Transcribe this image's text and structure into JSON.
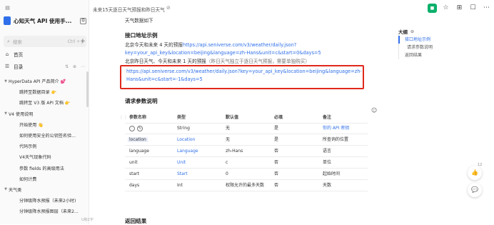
{
  "app": {
    "title": "心知天气 API 使用手...",
    "titlebar_icon": "tiny-window-icon"
  },
  "breadcrumb": {
    "text": "未来15天逐日天气预报和昨日天气"
  },
  "sidebar": {
    "search_placeholder": "搜索",
    "search_shortcut": "Ctrl + J",
    "nav": [
      {
        "label": "首页",
        "icon": "home-icon"
      },
      {
        "label": "目录",
        "icon": "list-icon",
        "tools": "⇅ ⊕ ⋯"
      }
    ],
    "tree": [
      {
        "label": "HyperData API 产品简介 💕",
        "indent": 1,
        "caret": true
      },
      {
        "label": "跳转至数据目录 👉",
        "indent": 2
      },
      {
        "label": "跳转至 V3 版 API 文档 👉",
        "indent": 2
      },
      {
        "label": "V4 使用说明",
        "indent": 1,
        "caret": true
      },
      {
        "label": "开始使用 👋",
        "indent": 2
      },
      {
        "label": "如何使用安全的公钥签名验...",
        "indent": 2
      },
      {
        "label": "代码示例",
        "indent": 2
      },
      {
        "label": "V4天气现象代码",
        "indent": 2
      },
      {
        "label": "参数 fields 的高级用法",
        "indent": 2
      },
      {
        "label": "如何计费",
        "indent": 2
      },
      {
        "label": "天气类",
        "indent": 1,
        "caret": true
      },
      {
        "label": "分钟级降水预报（未来2小时)",
        "indent": 2
      },
      {
        "label": "分钟级降水预报图层（未来2...",
        "indent": 2
      }
    ]
  },
  "content": {
    "intro_fragment": "天气数据如下",
    "section1_title": "接口地址示例",
    "line1_prefix": "北京今天和未来 4 天的预报",
    "line1_url": "https://api.seniverse.com/v3/weather/daily.json?",
    "line2_url": "key=your_api_key&location=beijing&language=zh-Hans&unit=c&start=0&days=5",
    "line3_prefix": "北京昨日天气、今天和未来 1 天的预报",
    "line3_note": "（昨日天气独立于逐日天气预报，需要单独购买）",
    "hl_line1": "https://api.seniverse.com/v3/weather/daily.json?key=your_api_key&location=beijing&language=zh-",
    "hl_line2": "Hans&unit=c&start=-1&days=5",
    "section2_title": "请求参数说明",
    "section3_title": "返回结果",
    "table": {
      "headers": [
        "参数名称",
        "类型",
        "默认值",
        "必填",
        "备注"
      ],
      "rows": [
        [
          "",
          "String",
          "无",
          "是",
          "你的 API 密钥"
        ],
        [
          "location",
          "Location",
          "无",
          "是",
          "所查询的位置"
        ],
        [
          "language",
          "Language",
          "zh-Hans",
          "否",
          "语言"
        ],
        [
          "unit",
          "Unit",
          "c",
          "否",
          "单位"
        ],
        [
          "start",
          "Start",
          "0",
          "否",
          "起始时间"
        ],
        [
          "days",
          "Int",
          "权限允许的最多天数",
          "否",
          "天数"
        ]
      ]
    }
  },
  "toc": {
    "title": "大纲",
    "items": [
      {
        "label": "接口地址示例",
        "active": true,
        "level": 1
      },
      {
        "label": "请求参数说明",
        "active": false,
        "level": 2
      },
      {
        "label": "返回结果",
        "active": false,
        "level": 1
      }
    ]
  },
  "float": {
    "like_count": "12"
  },
  "bottom_note": "U和2字"
}
